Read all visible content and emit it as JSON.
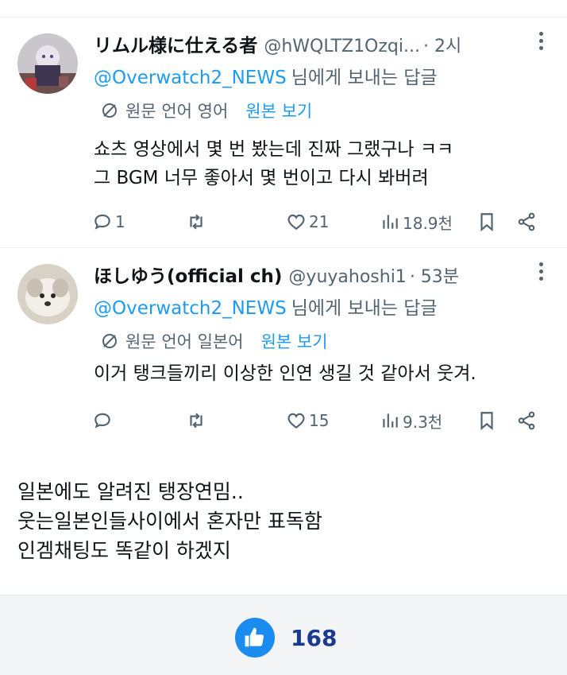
{
  "tweets": [
    {
      "name": "リムル様に仕える者",
      "handle": "@hWQLTZ1Ozqi...",
      "time": "· 2시",
      "reply_to": "@Overwatch2_NEWS",
      "reply_suffix": "님에게 보내는 답글",
      "translate_label": "원문 언어 영어",
      "translate_link": "원본 보기",
      "text_lines": [
        "쇼츠 영상에서 몇 번 봤는데 진짜 그랬구나 ㅋㅋ",
        "그 BGM 너무 좋아서 몇 번이고 다시 봐버려"
      ],
      "replies": "1",
      "retweets": "",
      "likes": "21",
      "views": "18.9천"
    },
    {
      "name": "ほしゆう(official ch)",
      "handle": "@yuyahoshi1",
      "time": "· 53분",
      "reply_to": "@Overwatch2_NEWS",
      "reply_suffix": "님에게 보내는 답글",
      "translate_label": "원문 언어 일본어",
      "translate_link": "원본 보기",
      "text_lines": [
        "이거 탱크들끼리 이상한 인연 생길 것 같아서 웃겨."
      ],
      "replies": "",
      "retweets": "",
      "likes": "15",
      "views": "9.3천"
    }
  ],
  "comment_lines": [
    "일본에도 알려진 탱장연밈..",
    "웃는일본인들사이에서 혼자만 표독함",
    "인겜채팅도 똑같이 하겠지"
  ],
  "footer": {
    "like_count": "168"
  },
  "colors": {
    "accent": "#1d9bf0",
    "muted": "#536471",
    "like_button": "#1a8cf0",
    "like_count": "#1a3a8c"
  }
}
